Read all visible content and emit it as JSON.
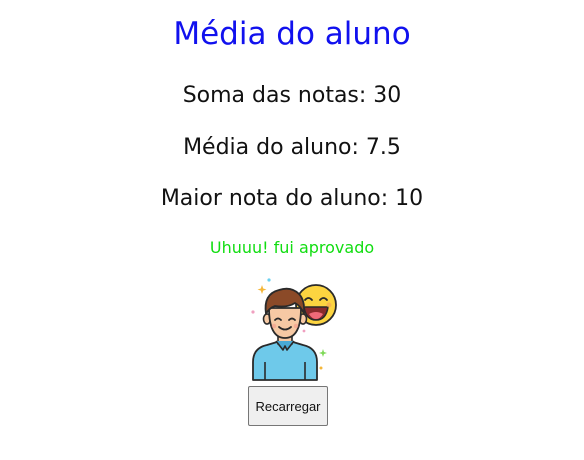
{
  "page": {
    "heading": "Média do aluno",
    "sum_line": "Soma das notas: 30",
    "average_line": "Média do aluno: 7.5",
    "max_line": "Maior nota do aluno: 10",
    "status_message": "Uhuuu! fui aprovado",
    "reload_button": "Recarregar"
  },
  "colors": {
    "heading": "#1111ee",
    "status": "#11dd11",
    "text": "#111111"
  },
  "icons": {
    "illustration": "happy-student-with-laughing-emoji-icon"
  }
}
